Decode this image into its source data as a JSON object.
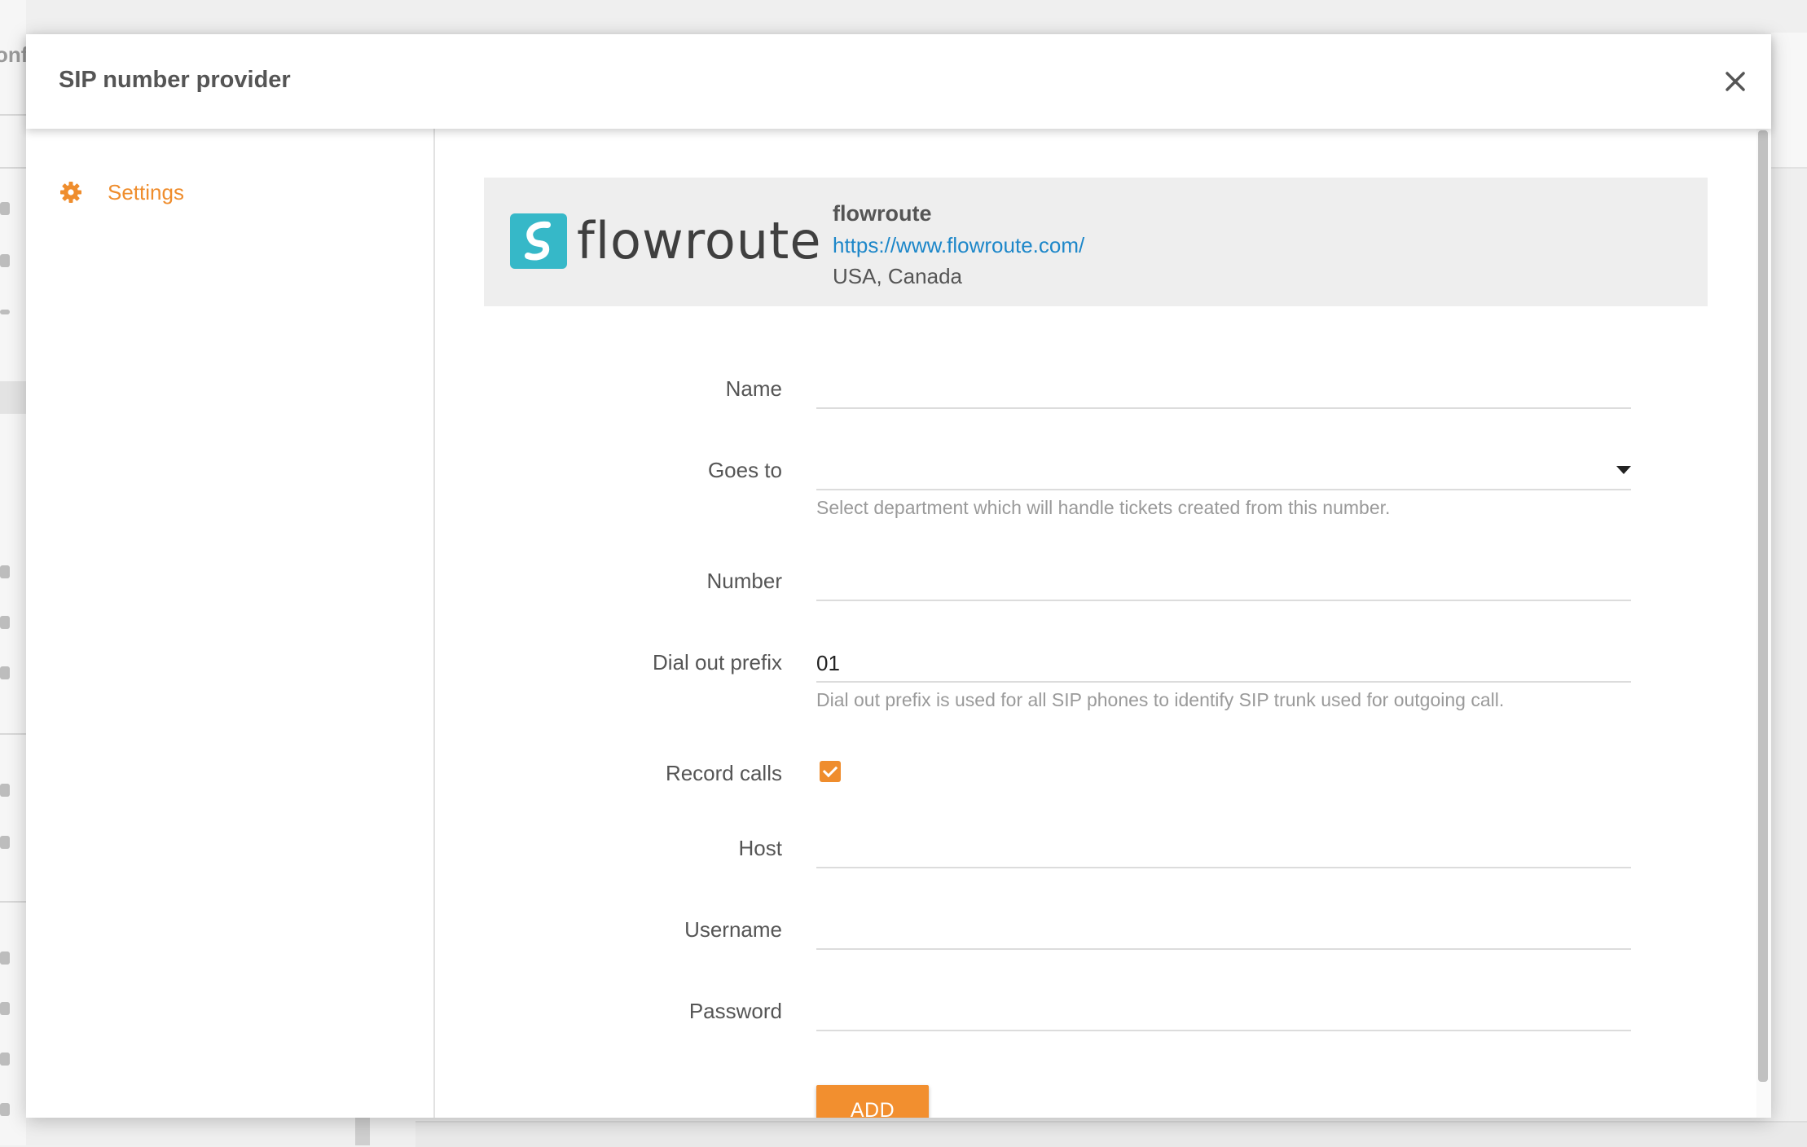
{
  "background": {
    "title_fragment": "onfi"
  },
  "modal": {
    "title": "SIP number provider",
    "close_icon": "close-icon"
  },
  "sidebar": {
    "items": [
      {
        "label": "Settings",
        "icon": "gear-icon",
        "active": true
      }
    ]
  },
  "provider": {
    "logo_text": "flowroute",
    "name": "flowroute",
    "url": "https://www.flowroute.com/",
    "region": "USA, Canada"
  },
  "form": {
    "name": {
      "label": "Name",
      "value": ""
    },
    "goes_to": {
      "label": "Goes to",
      "value": "",
      "hint": "Select department which will handle tickets created from this number."
    },
    "number": {
      "label": "Number",
      "value": ""
    },
    "dial_out_prefix": {
      "label": "Dial out prefix",
      "value": "01",
      "hint": "Dial out prefix is used for all SIP phones to identify SIP trunk used for outgoing call."
    },
    "record_calls": {
      "label": "Record calls",
      "checked": true
    },
    "host": {
      "label": "Host",
      "value": ""
    },
    "username": {
      "label": "Username",
      "value": ""
    },
    "password": {
      "label": "Password",
      "value": ""
    },
    "submit_label": "ADD"
  },
  "colors": {
    "accent": "#ef8d2d",
    "link": "#1d87c9",
    "logo_mark": "#36b8c8"
  }
}
